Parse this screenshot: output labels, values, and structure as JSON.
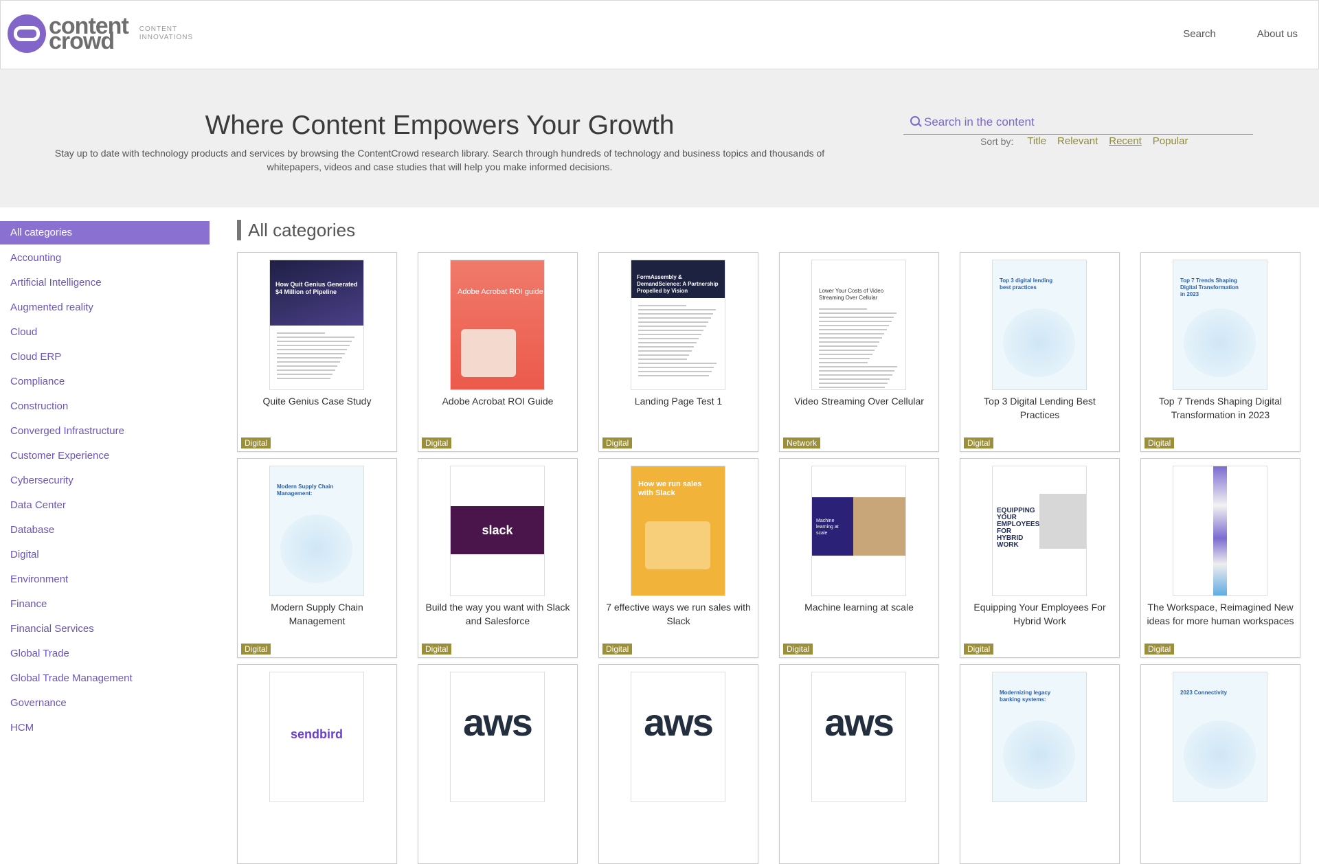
{
  "brand": {
    "logo_line1": "content",
    "logo_line2": "crowd",
    "tagline_line1": "CONTENT",
    "tagline_line2": "INNOVATIONS"
  },
  "nav": {
    "search": "Search",
    "about": "About us"
  },
  "hero": {
    "title": "Where Content Empowers Your Growth",
    "description": "Stay up to date with technology products and services by browsing the ContentCrowd research library. Search through hundreds of technology and business topics and thousands of whitepapers, videos and case studies that will help you make informed decisions.",
    "search_placeholder": "Search in the content",
    "sort_label": "Sort by:",
    "sort_options": [
      "Title",
      "Relevant",
      "Recent",
      "Popular"
    ],
    "sort_active": "Recent"
  },
  "colors": {
    "accent": "#8a70d0",
    "tag": "#9c8f3a",
    "sort_link": "#8f8a3a"
  },
  "sidebar": {
    "items": [
      "All categories",
      "Accounting",
      "Artificial Intelligence",
      "Augmented reality",
      "Cloud",
      "Cloud ERP",
      "Compliance",
      "Construction",
      "Converged Infrastructure",
      "Customer Experience",
      "Cybersecurity",
      "Data Center",
      "Database",
      "Digital",
      "Environment",
      "Finance",
      "Financial Services",
      "Global Trade",
      "Global Trade Management",
      "Governance",
      "HCM"
    ],
    "active": "All categories"
  },
  "main": {
    "section_title": "All categories",
    "cards": [
      {
        "title": "Quite Genius Case Study",
        "tag": "Digital",
        "thumb": "dark",
        "thumb_text": "How Quit Genius Generated $4 Million of Pipeline"
      },
      {
        "title": "Adobe Acrobat ROI Guide",
        "tag": "Digital",
        "thumb": "adobe",
        "thumb_text": "Adobe Acrobat ROI guide"
      },
      {
        "title": "Landing Page Test 1",
        "tag": "Digital",
        "thumb": "paper",
        "thumb_text": "FormAssembly & DemandScience: A Partnership Propelled by Vision"
      },
      {
        "title": "Video Streaming Over Cellular",
        "tag": "Network",
        "thumb": "text",
        "thumb_text": "Lower Your Costs of Video Streaming Over Cellular"
      },
      {
        "title": "Top 3 Digital Lending Best Practices",
        "tag": "Digital",
        "thumb": "light",
        "thumb_text": "Top 3 digital lending best practices"
      },
      {
        "title": "Top 7 Trends Shaping Digital Transformation in 2023",
        "tag": "Digital",
        "thumb": "light2",
        "thumb_text": "Top 7 Trends Shaping Digital Transformation in 2023"
      },
      {
        "title": "Modern Supply Chain Management",
        "tag": "Digital",
        "thumb": "light",
        "thumb_text": "Modern Supply Chain Management:"
      },
      {
        "title": "Build the way you want with Slack and Salesforce",
        "tag": "Digital",
        "thumb": "slack",
        "thumb_text": "slack"
      },
      {
        "title": "7 effective ways we run sales with Slack",
        "tag": "Digital",
        "thumb": "yellow",
        "thumb_text": "How we run sales with Slack"
      },
      {
        "title": "Machine learning at scale",
        "tag": "Digital",
        "thumb": "aws2",
        "thumb_text": "Machine learning at scale"
      },
      {
        "title": "Equipping Your Employees For Hybrid Work",
        "tag": "Digital",
        "thumb": "hybrid",
        "thumb_text": "EQUIPPING YOUR EMPLOYEES FOR HYBRID WORK"
      },
      {
        "title": "The Workspace, Reimagined New ideas for more human workspaces",
        "tag": "Digital",
        "thumb": "strip",
        "thumb_text": ""
      },
      {
        "title": "",
        "tag": "",
        "thumb": "sendbird",
        "thumb_text": "sendbird"
      },
      {
        "title": "",
        "tag": "",
        "thumb": "aws",
        "thumb_text": "aws"
      },
      {
        "title": "",
        "tag": "",
        "thumb": "aws",
        "thumb_text": "aws"
      },
      {
        "title": "",
        "tag": "",
        "thumb": "aws",
        "thumb_text": "aws"
      },
      {
        "title": "",
        "tag": "",
        "thumb": "light",
        "thumb_text": "Modernizing legacy banking systems:"
      },
      {
        "title": "",
        "tag": "",
        "thumb": "light2",
        "thumb_text": "2023 Connectivity"
      }
    ]
  }
}
